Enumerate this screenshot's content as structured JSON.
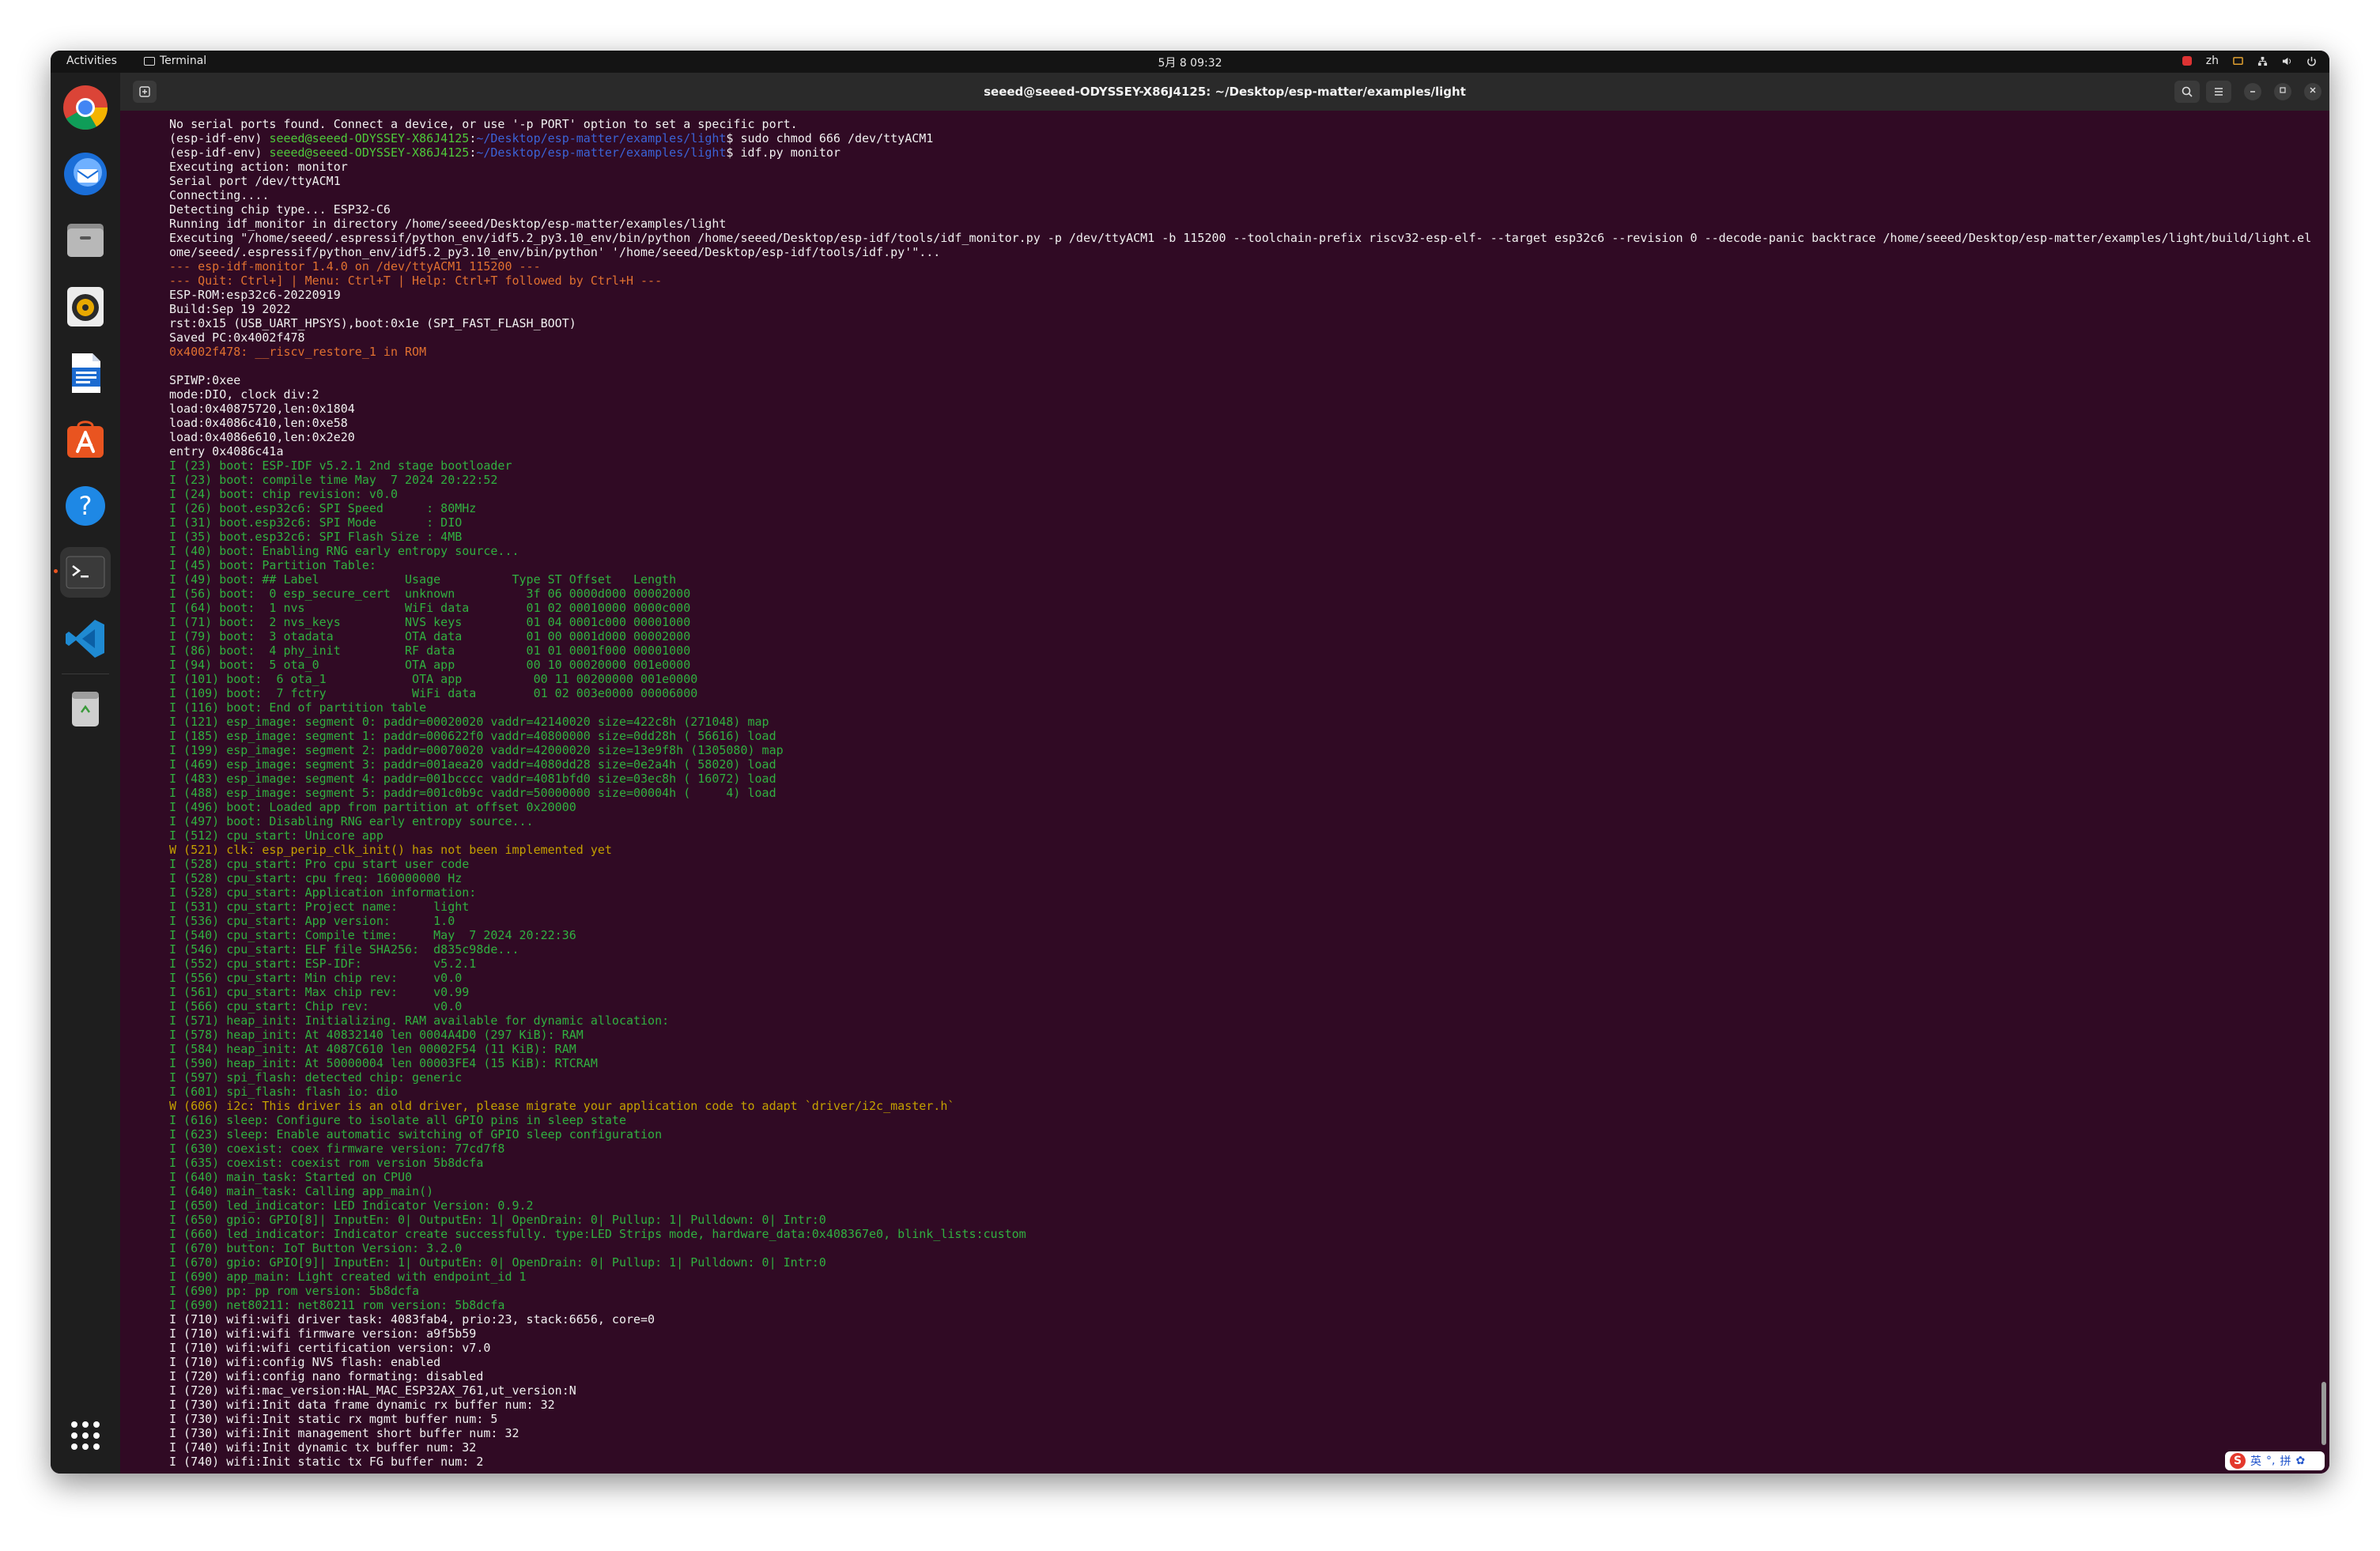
{
  "topbar": {
    "activities": "Activities",
    "app_name": "Terminal",
    "clock": "5月 8 09:32",
    "input_lang": "zh"
  },
  "dock": {
    "items": [
      "chrome-icon",
      "thunderbird-icon",
      "files-icon",
      "rhythmbox-icon",
      "writer-icon",
      "app-center-icon",
      "help-icon",
      "terminal-icon",
      "vscode-icon",
      "trash-icon",
      "app-grid-icon"
    ]
  },
  "window": {
    "title": "seeed@seeed-ODYSSEY-X86J4125: ~/Desktop/esp-matter/examples/light"
  },
  "ime": {
    "logo": "S",
    "lang": "英",
    "punct": "°,",
    "mode": "拼",
    "settings": "✿"
  },
  "terminal": {
    "prompt_user": "seeed@seeed-ODYSSEY-X86J4125",
    "prompt_path": "~/Desktop/esp-matter/examples/light",
    "lines": [
      {
        "t": "No serial ports found. Connect a device, or use '-p PORT' option to set a specific port.",
        "c": "wht"
      },
      {
        "env": "(esp-idf-env) ",
        "cmd": "$ sudo chmod 666 /dev/ttyACM1",
        "kind": "prompt"
      },
      {
        "env": "(esp-idf-env) ",
        "cmd": "$ idf.py monitor",
        "kind": "prompt"
      },
      {
        "t": "Executing action: monitor",
        "c": "wht"
      },
      {
        "t": "Serial port /dev/ttyACM1",
        "c": "wht"
      },
      {
        "t": "Connecting....",
        "c": "wht"
      },
      {
        "t": "Detecting chip type... ESP32-C6",
        "c": "wht"
      },
      {
        "t": "Running idf_monitor in directory /home/seeed/Desktop/esp-matter/examples/light",
        "c": "wht"
      },
      {
        "t": "Executing \"/home/seeed/.espressif/python_env/idf5.2_py3.10_env/bin/python /home/seeed/Desktop/esp-idf/tools/idf_monitor.py -p /dev/ttyACM1 -b 115200 --toolchain-prefix riscv32-esp-elf- --target esp32c6 --revision 0 --decode-panic backtrace /home/seeed/Desktop/esp-matter/examples/light/build/light.elf -m '/h",
        "c": "wht"
      },
      {
        "t": "ome/seeed/.espressif/python_env/idf5.2_py3.10_env/bin/python' '/home/seeed/Desktop/esp-idf/tools/idf.py'\"...",
        "c": "wht"
      },
      {
        "t": "--- esp-idf-monitor 1.4.0 on /dev/ttyACM1 115200 ---",
        "c": "w"
      },
      {
        "t": "--- Quit: Ctrl+] | Menu: Ctrl+T | Help: Ctrl+T followed by Ctrl+H ---",
        "c": "w"
      },
      {
        "t": "ESP-ROM:esp32c6-20220919",
        "c": "wht"
      },
      {
        "t": "Build:Sep 19 2022",
        "c": "wht"
      },
      {
        "t": "rst:0x15 (USB_UART_HPSYS),boot:0x1e (SPI_FAST_FLASH_BOOT)",
        "c": "wht"
      },
      {
        "t": "Saved PC:0x4002f478",
        "c": "wht"
      },
      {
        "t": "0x4002f478: __riscv_restore_1 in ROM",
        "c": "w"
      },
      {
        "t": "",
        "c": "wht"
      },
      {
        "t": "SPIWP:0xee",
        "c": "wht"
      },
      {
        "t": "mode:DIO, clock div:2",
        "c": "wht"
      },
      {
        "t": "load:0x40875720,len:0x1804",
        "c": "wht"
      },
      {
        "t": "load:0x4086c410,len:0xe58",
        "c": "wht"
      },
      {
        "t": "load:0x4086e610,len:0x2e20",
        "c": "wht"
      },
      {
        "t": "entry 0x4086c41a",
        "c": "wht"
      },
      {
        "t": "I (23) boot: ESP-IDF v5.2.1 2nd stage bootloader",
        "c": "g"
      },
      {
        "t": "I (23) boot: compile time May  7 2024 20:22:52",
        "c": "g"
      },
      {
        "t": "I (24) boot: chip revision: v0.0",
        "c": "g"
      },
      {
        "t": "I (26) boot.esp32c6: SPI Speed      : 80MHz",
        "c": "g"
      },
      {
        "t": "I (31) boot.esp32c6: SPI Mode       : DIO",
        "c": "g"
      },
      {
        "t": "I (35) boot.esp32c6: SPI Flash Size : 4MB",
        "c": "g"
      },
      {
        "t": "I (40) boot: Enabling RNG early entropy source...",
        "c": "g"
      },
      {
        "t": "I (45) boot: Partition Table:",
        "c": "g"
      },
      {
        "t": "I (49) boot: ## Label            Usage          Type ST Offset   Length",
        "c": "g"
      },
      {
        "t": "I (56) boot:  0 esp_secure_cert  unknown          3f 06 0000d000 00002000",
        "c": "g"
      },
      {
        "t": "I (64) boot:  1 nvs              WiFi data        01 02 00010000 0000c000",
        "c": "g"
      },
      {
        "t": "I (71) boot:  2 nvs_keys         NVS keys         01 04 0001c000 00001000",
        "c": "g"
      },
      {
        "t": "I (79) boot:  3 otadata          OTA data         01 00 0001d000 00002000",
        "c": "g"
      },
      {
        "t": "I (86) boot:  4 phy_init         RF data          01 01 0001f000 00001000",
        "c": "g"
      },
      {
        "t": "I (94) boot:  5 ota_0            OTA app          00 10 00020000 001e0000",
        "c": "g"
      },
      {
        "t": "I (101) boot:  6 ota_1            OTA app          00 11 00200000 001e0000",
        "c": "g"
      },
      {
        "t": "I (109) boot:  7 fctry            WiFi data        01 02 003e0000 00006000",
        "c": "g"
      },
      {
        "t": "I (116) boot: End of partition table",
        "c": "g"
      },
      {
        "t": "I (121) esp_image: segment 0: paddr=00020020 vaddr=42140020 size=422c8h (271048) map",
        "c": "g"
      },
      {
        "t": "I (185) esp_image: segment 1: paddr=000622f0 vaddr=40800000 size=0dd28h ( 56616) load",
        "c": "g"
      },
      {
        "t": "I (199) esp_image: segment 2: paddr=00070020 vaddr=42000020 size=13e9f8h (1305080) map",
        "c": "g"
      },
      {
        "t": "I (469) esp_image: segment 3: paddr=001aea20 vaddr=4080dd28 size=0e2a4h ( 58020) load",
        "c": "g"
      },
      {
        "t": "I (483) esp_image: segment 4: paddr=001bcccc vaddr=4081bfd0 size=03ec8h ( 16072) load",
        "c": "g"
      },
      {
        "t": "I (488) esp_image: segment 5: paddr=001c0b9c vaddr=50000000 size=00004h (     4) load",
        "c": "g"
      },
      {
        "t": "I (496) boot: Loaded app from partition at offset 0x20000",
        "c": "g"
      },
      {
        "t": "I (497) boot: Disabling RNG early entropy source...",
        "c": "g"
      },
      {
        "t": "I (512) cpu_start: Unicore app",
        "c": "g"
      },
      {
        "t": "W (521) clk: esp_perip_clk_init() has not been implemented yet",
        "c": "y"
      },
      {
        "t": "I (528) cpu_start: Pro cpu start user code",
        "c": "g"
      },
      {
        "t": "I (528) cpu_start: cpu freq: 160000000 Hz",
        "c": "g"
      },
      {
        "t": "I (528) cpu_start: Application information:",
        "c": "g"
      },
      {
        "t": "I (531) cpu_start: Project name:     light",
        "c": "g"
      },
      {
        "t": "I (536) cpu_start: App version:      1.0",
        "c": "g"
      },
      {
        "t": "I (540) cpu_start: Compile time:     May  7 2024 20:22:36",
        "c": "g"
      },
      {
        "t": "I (546) cpu_start: ELF file SHA256:  d835c98de...",
        "c": "g"
      },
      {
        "t": "I (552) cpu_start: ESP-IDF:          v5.2.1",
        "c": "g"
      },
      {
        "t": "I (556) cpu_start: Min chip rev:     v0.0",
        "c": "g"
      },
      {
        "t": "I (561) cpu_start: Max chip rev:     v0.99",
        "c": "g"
      },
      {
        "t": "I (566) cpu_start: Chip rev:         v0.0",
        "c": "g"
      },
      {
        "t": "I (571) heap_init: Initializing. RAM available for dynamic allocation:",
        "c": "g"
      },
      {
        "t": "I (578) heap_init: At 40832140 len 0004A4D0 (297 KiB): RAM",
        "c": "g"
      },
      {
        "t": "I (584) heap_init: At 4087C610 len 00002F54 (11 KiB): RAM",
        "c": "g"
      },
      {
        "t": "I (590) heap_init: At 50000004 len 00003FE4 (15 KiB): RTCRAM",
        "c": "g"
      },
      {
        "t": "I (597) spi_flash: detected chip: generic",
        "c": "g"
      },
      {
        "t": "I (601) spi_flash: flash io: dio",
        "c": "g"
      },
      {
        "t": "W (606) i2c: This driver is an old driver, please migrate your application code to adapt `driver/i2c_master.h`",
        "c": "y"
      },
      {
        "t": "I (616) sleep: Configure to isolate all GPIO pins in sleep state",
        "c": "g"
      },
      {
        "t": "I (623) sleep: Enable automatic switching of GPIO sleep configuration",
        "c": "g"
      },
      {
        "t": "I (630) coexist: coex firmware version: 77cd7f8",
        "c": "g"
      },
      {
        "t": "I (635) coexist: coexist rom version 5b8dcfa",
        "c": "g"
      },
      {
        "t": "I (640) main_task: Started on CPU0",
        "c": "g"
      },
      {
        "t": "I (640) main_task: Calling app_main()",
        "c": "g"
      },
      {
        "t": "I (650) led_indicator: LED Indicator Version: 0.9.2",
        "c": "g"
      },
      {
        "t": "I (650) gpio: GPIO[8]| InputEn: 0| OutputEn: 1| OpenDrain: 0| Pullup: 1| Pulldown: 0| Intr:0",
        "c": "g"
      },
      {
        "t": "I (660) led_indicator: Indicator create successfully. type:LED Strips mode, hardware_data:0x408367e0, blink_lists:custom",
        "c": "g"
      },
      {
        "t": "I (670) button: IoT Button Version: 3.2.0",
        "c": "g"
      },
      {
        "t": "I (670) gpio: GPIO[9]| InputEn: 1| OutputEn: 0| OpenDrain: 0| Pullup: 1| Pulldown: 0| Intr:0",
        "c": "g"
      },
      {
        "t": "I (690) app_main: Light created with endpoint_id 1",
        "c": "g"
      },
      {
        "t": "I (690) pp: pp rom version: 5b8dcfa",
        "c": "g"
      },
      {
        "t": "I (690) net80211: net80211 rom version: 5b8dcfa",
        "c": "g"
      },
      {
        "t": "I (710) wifi:wifi driver task: 4083fab4, prio:23, stack:6656, core=0",
        "c": "wht"
      },
      {
        "t": "I (710) wifi:wifi firmware version: a9f5b59",
        "c": "wht"
      },
      {
        "t": "I (710) wifi:wifi certification version: v7.0",
        "c": "wht"
      },
      {
        "t": "I (710) wifi:config NVS flash: enabled",
        "c": "wht"
      },
      {
        "t": "I (720) wifi:config nano formating: disabled",
        "c": "wht"
      },
      {
        "t": "I (720) wifi:mac_version:HAL_MAC_ESP32AX_761,ut_version:N",
        "c": "wht"
      },
      {
        "t": "I (730) wifi:Init data frame dynamic rx buffer num: 32",
        "c": "wht"
      },
      {
        "t": "I (730) wifi:Init static rx mgmt buffer num: 5",
        "c": "wht"
      },
      {
        "t": "I (730) wifi:Init management short buffer num: 32",
        "c": "wht"
      },
      {
        "t": "I (740) wifi:Init dynamic tx buffer num: 32",
        "c": "wht"
      },
      {
        "t": "I (740) wifi:Init static tx FG buffer num: 2",
        "c": "wht"
      }
    ]
  }
}
